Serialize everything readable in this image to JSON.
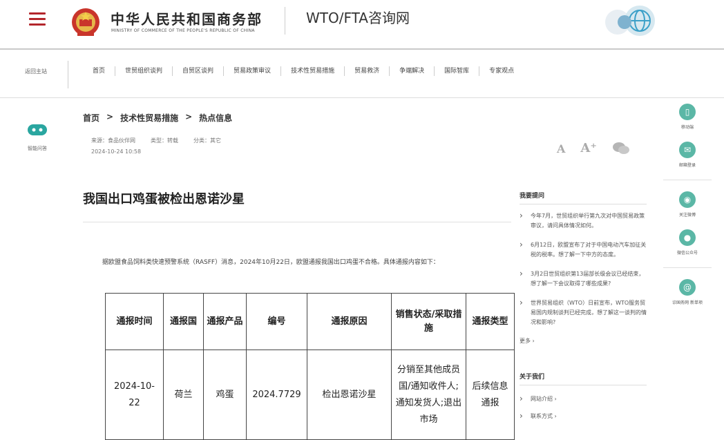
{
  "header": {
    "site_name_cn": "中华人民共和国商务部",
    "site_name_en": "MINISTRY OF COMMERCE OF THE PEOPLE'S REPUBLIC OF CHINA",
    "portal_title": "WTO/FTA咨询网",
    "accent": "#b3262b"
  },
  "nav": {
    "home": "返回主站",
    "items": [
      "首页",
      "世贸组织谈判",
      "自贸区谈判",
      "贸易政策审议",
      "技术性贸易措施",
      "贸易救济",
      "争端解决",
      "国际智库",
      "专家观点"
    ]
  },
  "left_rail": {
    "assistant_label": "智能问答"
  },
  "breadcrumb": [
    "首页",
    "技术性贸易措施",
    "热点信息"
  ],
  "meta": {
    "source": "来源：食品伙伴网",
    "type": "类型：转载",
    "category": "分类：其它",
    "date": "2024-10-24 10:58"
  },
  "font_tools": {
    "decrease": "A",
    "increase": "A⁺"
  },
  "article": {
    "title": "我国出口鸡蛋被检出恩诺沙星",
    "intro": "据欧盟食品饲料类快速预警系统（RASFF）消息，2024年10月22日，欧盟通报我国出口鸡蛋不合格。具体通报内容如下：",
    "table": {
      "headers": [
        "通报时间",
        "通报国",
        "通报产品",
        "编号",
        "通报原因",
        "销售状态/采取措施",
        "通报类型"
      ],
      "rows": [
        [
          "2024-10-22",
          "荷兰",
          "鸡蛋",
          "2024.7729",
          "检出恩诺沙星",
          "分销至其他成员国/通知收件人;通知发货人;退出市场",
          "后续信息通报"
        ]
      ]
    }
  },
  "sidebar": {
    "questions_title": "我要提问",
    "questions": [
      "今年7月，世贸组织举行第九次对中国贸易政策审议，请问具体情况如何。",
      "6月12日，欧盟宣布了对于中国电动汽车加征关税的税率。想了解一下中方的态度。",
      "3月2日世贸组织第13届部长级会议已经结束，想了解一下会议取得了哪些成果?",
      "世界贸易组织（WTO）日前宣布，WTO服务贸易国内规制谈判已经完成，想了解这一谈判的情况和影响?"
    ],
    "more": "更多 ›",
    "about_title": "关于我们",
    "about_items": [
      "网站介绍 ›",
      "联系方式 ›"
    ]
  },
  "right_rail": {
    "items": [
      {
        "label": "移动端",
        "icon": "mobile-icon"
      },
      {
        "label": "邮箱登录",
        "icon": "mail-icon"
      },
      {
        "label": "关注微博",
        "icon": "weibo-icon"
      },
      {
        "label": "微信公众号",
        "icon": "wechat-icon"
      },
      {
        "label": "诊国务网 新单项",
        "icon": "web-icon"
      }
    ],
    "color": "#5bb7a6"
  }
}
